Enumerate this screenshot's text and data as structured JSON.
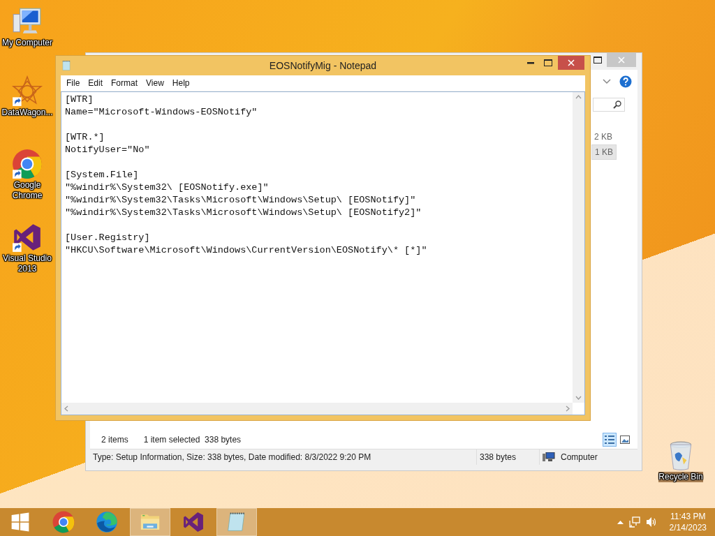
{
  "desktop_icons": [
    {
      "kind": "computer",
      "label": "My Computer"
    },
    {
      "kind": "datawagon",
      "label": "DataWagon..."
    },
    {
      "kind": "chrome",
      "label": "Google Chrome"
    },
    {
      "kind": "visualstudio",
      "label": "Visual Studio 2013"
    }
  ],
  "recycle_bin": {
    "kind": "recycle",
    "label": "Recycle Bin"
  },
  "explorer": {
    "sizes": [
      {
        "text": "2 KB",
        "selected": false
      },
      {
        "text": "1 KB",
        "selected": true
      }
    ],
    "item_count": "2 items",
    "selection": "1 item selected  338 bytes",
    "view_buttons": [
      {
        "kind": "details",
        "selected": true
      },
      {
        "kind": "thumbnails",
        "selected": false
      }
    ],
    "status_bar": {
      "details": "Type: Setup Information, Size: 338 bytes, Date modified: 8/3/2022 9:20 PM",
      "size": "338 bytes",
      "zone": "Computer"
    }
  },
  "notepad": {
    "title": "EOSNotifyMig - Notepad",
    "menu": [
      "File",
      "Edit",
      "Format",
      "View",
      "Help"
    ],
    "sections": [
      {
        "lines": [
          "[WTR]",
          "Name=\"Microsoft-Windows-EOSNotify\""
        ]
      },
      {
        "lines": [
          "[WTR.*]",
          "NotifyUser=\"No\""
        ]
      },
      {
        "lines": [
          "[System.File]",
          "\"%windir%\\System32\\ [EOSNotify.exe]\"",
          "\"%windir%\\System32\\Tasks\\Microsoft\\Windows\\Setup\\ [EOSNotify]\"",
          "\"%windir%\\System32\\Tasks\\Microsoft\\Windows\\Setup\\ [EOSNotify2]\""
        ]
      },
      {
        "lines": [
          "[User.Registry]",
          "\"HKCU\\Software\\Microsoft\\Windows\\CurrentVersion\\EOSNotify\\* [*]\""
        ]
      }
    ]
  },
  "taskbar": {
    "apps": [
      {
        "kind": "start",
        "running": false
      },
      {
        "kind": "chrome",
        "running": false
      },
      {
        "kind": "edge",
        "running": false
      },
      {
        "kind": "explorer",
        "running": true
      },
      {
        "kind": "visualstudio",
        "running": false
      },
      {
        "kind": "notepad",
        "running": true
      }
    ],
    "time": "11:43 PM",
    "date": "2/14/2023"
  }
}
